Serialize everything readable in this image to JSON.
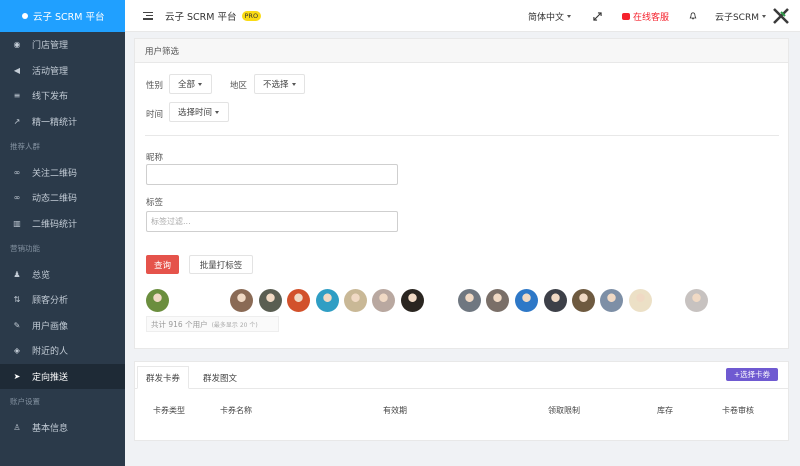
{
  "sidebar": {
    "brand": "云子 SCRM 平台",
    "items": [
      {
        "type": "item",
        "label": "门店管理",
        "icon": "location-pin-icon"
      },
      {
        "type": "item",
        "label": "活动管理",
        "icon": "megaphone-icon"
      },
      {
        "type": "item",
        "label": "线下发布",
        "icon": "list-icon"
      },
      {
        "type": "item",
        "label": "精一精统计",
        "icon": "trend-icon"
      },
      {
        "type": "group",
        "label": "推荐人群"
      },
      {
        "type": "item",
        "label": "关注二维码",
        "icon": "link-icon"
      },
      {
        "type": "item",
        "label": "动态二维码",
        "icon": "link-icon"
      },
      {
        "type": "item",
        "label": "二维码统计",
        "icon": "bar-chart-icon"
      },
      {
        "type": "group",
        "label": "营销功能"
      },
      {
        "type": "item",
        "label": "总览",
        "icon": "users-icon"
      },
      {
        "type": "item",
        "label": "顾客分析",
        "icon": "sort-icon"
      },
      {
        "type": "item",
        "label": "用户画像",
        "icon": "pen-icon"
      },
      {
        "type": "item",
        "label": "附近的人",
        "icon": "compass-icon"
      },
      {
        "type": "item",
        "label": "定向推送",
        "icon": "send-icon",
        "active": true
      },
      {
        "type": "group",
        "label": "账户设置"
      },
      {
        "type": "item",
        "label": "基本信息",
        "icon": "user-icon"
      }
    ]
  },
  "header": {
    "title": "云子 SCRM 平台",
    "badge": "PRO",
    "language": "简体中文",
    "service": "在线客服",
    "user": "云子SCRM"
  },
  "filter": {
    "title": "用户筛选",
    "gender_label": "性别",
    "gender_value": "全部",
    "region_label": "地区",
    "region_value": "不选择",
    "time_label": "时间",
    "time_value": "选择时间",
    "nickname_label": "昵称",
    "nickname_value": "",
    "tag_label": "标签",
    "tag_placeholder": "标签过滤...",
    "query_button": "查询",
    "batch_tag_button": "批量打标签",
    "total_text": "共计 916 个用户",
    "total_note": "(最多显示 20 个)"
  },
  "avatars": [
    {
      "color": "#6b8e3e",
      "name": "avatar-1"
    },
    {
      "color": "#8a6a55",
      "name": "avatar-2"
    },
    {
      "color": "#5a5e52",
      "name": "avatar-3"
    },
    {
      "color": "#d2512b",
      "name": "avatar-4"
    },
    {
      "color": "#2f9ec4",
      "name": "avatar-5"
    },
    {
      "color": "#c9b896",
      "name": "avatar-6"
    },
    {
      "color": "#b9a8a0",
      "name": "avatar-7"
    },
    {
      "color": "#2a2520",
      "name": "avatar-8"
    },
    {
      "color": "#6f7780",
      "name": "avatar-9"
    },
    {
      "color": "#7a6f68",
      "name": "avatar-10"
    },
    {
      "color": "#2e78c7",
      "name": "avatar-11"
    },
    {
      "color": "#3d4048",
      "name": "avatar-12"
    },
    {
      "color": "#6e5a40",
      "name": "avatar-13"
    },
    {
      "color": "#7d8fa6",
      "name": "avatar-14"
    },
    {
      "color": "#ece0c6",
      "name": "avatar-15"
    },
    {
      "color": "#c7c2c0",
      "name": "avatar-16"
    }
  ],
  "coupon": {
    "tab_card": "群发卡券",
    "tab_message": "群发图文",
    "select_button": "+选择卡券",
    "columns": [
      "卡券类型",
      "卡券名称",
      "有效期",
      "领取限制",
      "库存",
      "卡卷审核"
    ]
  }
}
